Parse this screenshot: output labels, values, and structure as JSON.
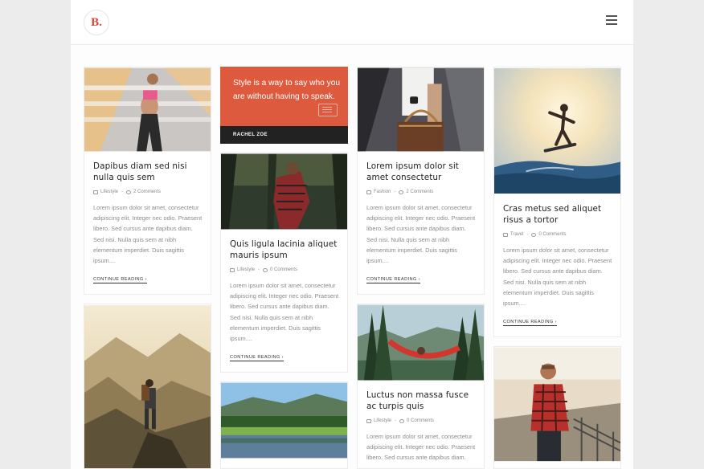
{
  "header": {
    "logo_text": "B.",
    "menu_icon": "hamburger-icon"
  },
  "quote": {
    "text": "Style is a way to say who you are without having to speak.",
    "author": "RACHEL ZOE",
    "icon": "speech-bubble-icon"
  },
  "posts": [
    {
      "title": "Dapibus diam sed nisi nulla quis sem",
      "category": "Lifestyle",
      "comments": "2 Comments",
      "excerpt": "Lorem ipsum dolor sit amet, consectetur adipiscing elit. Integer nec odio. Praesent libero. Sed cursus ante dapibus diam. Sed nisi. Nulla quis sem at nibh elementum imperdiet. Duis sagittis ipsum....",
      "more": "CONTINUE READING ›"
    },
    {
      "title": "Quis ligula lacinia aliquet mauris ipsum",
      "category": "Lifestyle",
      "comments": "0 Comments",
      "excerpt": "Lorem ipsum dolor sit amet, consectetur adipiscing elit. Integer nec odio. Praesent libero. Sed cursus ante dapibus diam. Sed nisi. Nulla quis sem at nibh elementum imperdiet. Duis sagittis ipsum....",
      "more": "CONTINUE READING ›"
    },
    {
      "title": "Lorem ipsum dolor sit amet consectetur",
      "category": "Fashion",
      "comments": "2 Comments",
      "excerpt": "Lorem ipsum dolor sit amet, consectetur adipiscing elit. Integer nec odio. Praesent libero. Sed cursus ante dapibus diam. Sed nisi. Nulla quis sem at nibh elementum imperdiet. Duis sagittis ipsum....",
      "more": "CONTINUE READING ›"
    },
    {
      "title": "Cras metus sed aliquet risus a tortor",
      "category": "Travel",
      "comments": "0 Comments",
      "excerpt": "Lorem ipsum dolor sit amet, consectetur adipiscing elit. Integer nec odio. Praesent libero. Sed cursus ante dapibus diam. Sed nisi. Nulla quis sem at nibh elementum imperdiet. Duis sagittis ipsum....",
      "more": "CONTINUE READING ›"
    },
    {
      "title": "Luctus non massa fusce ac turpis quis",
      "category": "Lifestyle",
      "comments": "0 Comments",
      "excerpt": "Lorem ipsum dolor sit amet, consectetur adipiscing elit. Integer nec odio. Praesent libero. Sed cursus ante dapibus diam.",
      "more": ""
    }
  ],
  "icons": {
    "folder": "folder-icon",
    "comment": "comment-icon"
  },
  "colors": {
    "accent": "#dd5a3e",
    "dark": "#222222",
    "text_muted": "#8c8c8c"
  }
}
